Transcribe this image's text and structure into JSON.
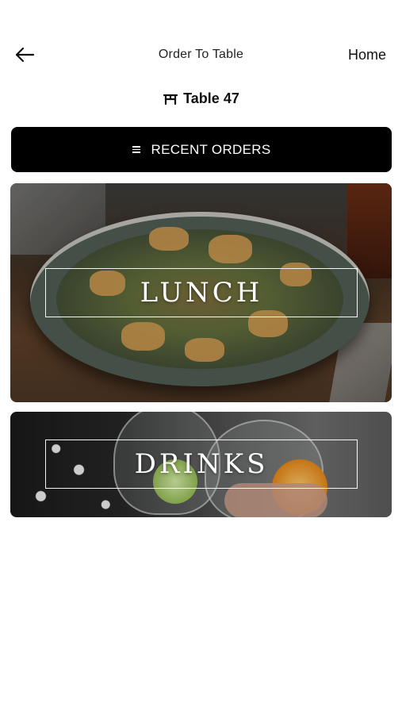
{
  "header": {
    "back_icon": "arrow-left-icon",
    "title": "Order To Table",
    "home_label": "Home"
  },
  "table": {
    "icon": "table-icon",
    "label": "Table 47"
  },
  "recent_orders": {
    "icon": "menu-lines-icon",
    "label": "RECENT ORDERS"
  },
  "categories": [
    {
      "label": "LUNCH"
    },
    {
      "label": "DRINKS"
    }
  ],
  "colors": {
    "background": "#ffffff",
    "button_bg": "#000000",
    "button_text": "#ffffff"
  }
}
